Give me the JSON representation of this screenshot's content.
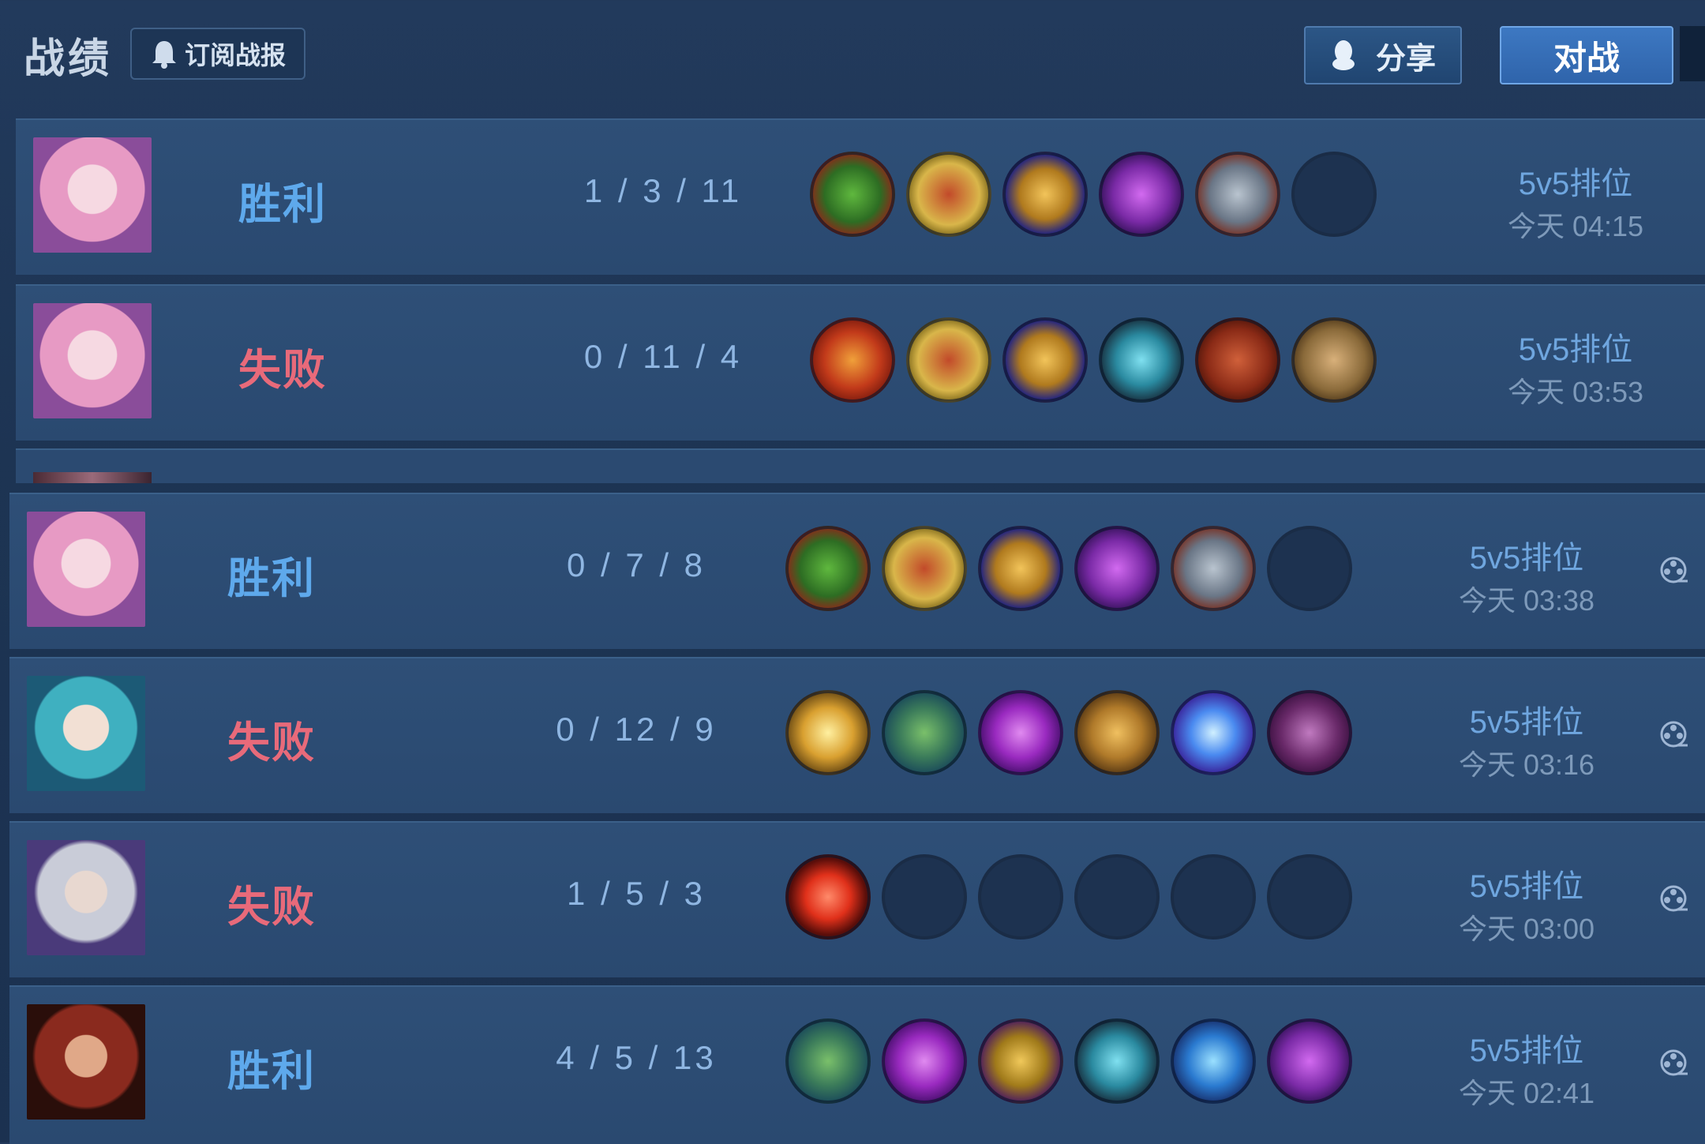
{
  "header": {
    "title": "战绩",
    "subscribe_label": "订阅战报",
    "share_label": "分享",
    "battle_label": "对战"
  },
  "colors": {
    "win": "#5ea9ec",
    "loss": "#e86a7a",
    "accent": "#3d78c2"
  },
  "matches": [
    {
      "result": "胜利",
      "outcome": "win",
      "kda": "1 / 3 / 11",
      "mode": "5v5排位",
      "time": "今天 04:15",
      "portrait": "pink-hair-hero",
      "items": [
        "green-jade-item",
        "gold-armor-item",
        "golden-chalice-item",
        "purple-rune-item",
        "steel-armor-item",
        "empty-slot"
      ]
    },
    {
      "result": "失败",
      "outcome": "loss",
      "kda": "0 / 11 / 4",
      "mode": "5v5排位",
      "time": "今天 03:53",
      "portrait": "pink-hair-hero",
      "items": [
        "red-crest-item",
        "gold-armor-item",
        "golden-chalice-item",
        "cyan-axe-item",
        "red-tome-item",
        "wooden-shield-item"
      ]
    },
    {
      "result": "胜利",
      "outcome": "win",
      "kda": "0 / 7 / 8",
      "mode": "5v5排位",
      "time": "今天 03:38",
      "portrait": "pink-hair-hero",
      "items": [
        "green-jade-item",
        "gold-armor-item",
        "golden-chalice-item",
        "purple-rune-item",
        "steel-armor-item",
        "empty-slot"
      ]
    },
    {
      "result": "失败",
      "outcome": "loss",
      "kda": "0 / 12 / 9",
      "mode": "5v5排位",
      "time": "今天 03:16",
      "portrait": "teal-hair-hero",
      "items": [
        "golden-wing-item",
        "green-boots-item",
        "purple-spear-item",
        "bronze-hammer-item",
        "blue-crystal-item",
        "purple-tome-item"
      ]
    },
    {
      "result": "失败",
      "outcome": "loss",
      "kda": "1 / 5 / 3",
      "mode": "5v5排位",
      "time": "今天 03:00",
      "portrait": "silver-hair-hero",
      "items": [
        "red-gem-item",
        "empty-slot",
        "empty-slot",
        "empty-slot",
        "empty-slot",
        "empty-slot"
      ]
    },
    {
      "result": "胜利",
      "outcome": "win",
      "kda": "4 / 5 / 13",
      "mode": "5v5排位",
      "time": "今天 02:41",
      "portrait": "red-hair-hero",
      "items": [
        "green-boots-item",
        "purple-spear-item",
        "golden-cloak-item",
        "cyan-axe-item",
        "blue-orb-staff-item",
        "purple-rune-item"
      ]
    }
  ]
}
